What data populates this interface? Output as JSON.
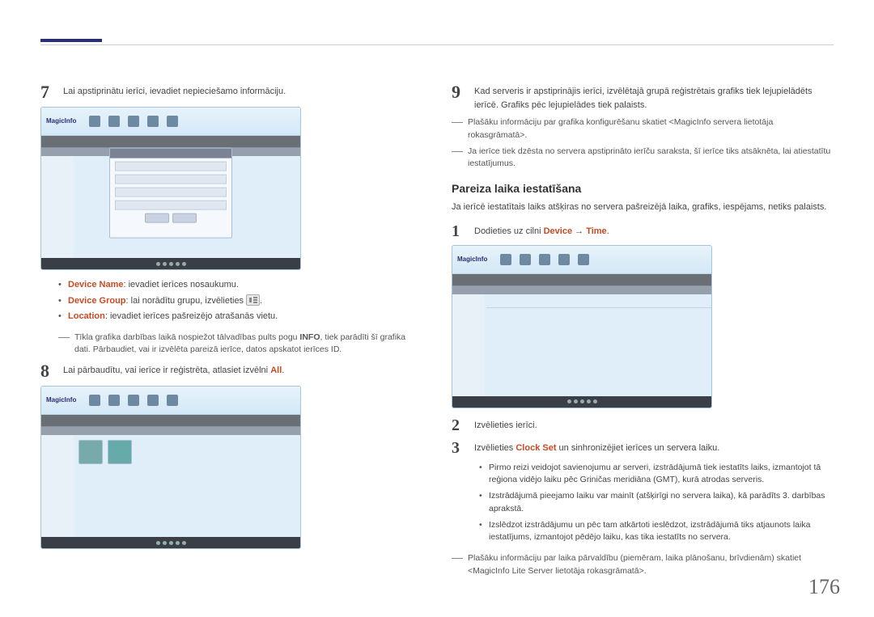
{
  "accentColor": "#c84a22",
  "page_number": "176",
  "left": {
    "step7": {
      "num": "7",
      "text": "Lai apstiprinātu ierīci, ievadiet nepieciešamo informāciju."
    },
    "bullets": {
      "b1_label": "Device Name",
      "b1_text": ": ievadiet ierīces nosaukumu.",
      "b2_label": "Device Group",
      "b2_text_a": ": lai norādītu grupu, izvēlieties ",
      "b2_text_b": ".",
      "b3_label": "Location",
      "b3_text": ": ievadiet ierīces pašreizējo atrašanās vietu."
    },
    "note_info": {
      "pre": "Tīkla grafika darbības laikā nospiežot tālvadības pults pogu ",
      "kw": "INFO",
      "post": ", tiek parādīti šī grafika dati. Pārbaudiet, vai ir izvēlēta pareizā ierīce, datos apskatot ierīces ID."
    },
    "step8": {
      "num": "8",
      "pre": "Lai pārbaudītu, vai ierīce ir reģistrēta, atlasiet izvēlni ",
      "kw": "All",
      "post": "."
    }
  },
  "right": {
    "step9": {
      "num": "9",
      "text": "Kad serveris ir apstiprinājis ierīci, izvēlētajā grupā reģistrētais grafiks tiek lejupielādēts ierīcē. Grafiks pēc lejupielādes tiek palaists."
    },
    "note1": "Plašāku informāciju par grafika konfigurēšanu skatiet <MagicInfo servera lietotāja rokasgrāmatā>.",
    "note2": "Ja ierīce tiek dzēsta no servera apstiprināto ierīču saraksta, šī ierīce tiks atsāknēta, lai atiestatītu iestatījumus.",
    "section_title": "Pareiza laika iestatīšana",
    "section_desc": "Ja ierīcē iestatītais laiks atšķiras no servera pašreizējā laika, grafiks, iespējams, netiks palaists.",
    "step1": {
      "num": "1",
      "pre": "Dodieties uz cilni ",
      "kw1": "Device",
      "arrow": " → ",
      "kw2": "Time",
      "post": "."
    },
    "step2": {
      "num": "2",
      "text": "Izvēlieties ierīci."
    },
    "step3": {
      "num": "3",
      "pre": "Izvēlieties ",
      "kw": "Clock Set",
      "post": " un sinhronizējiet ierīces un servera laiku."
    },
    "sub_bullets": {
      "s1": "Pirmo reizi veidojot savienojumu ar serveri, izstrādājumā tiek iestatīts laiks, izmantojot tā reģiona vidējo laiku pēc Griničas meridiāna (GMT), kurā atrodas serveris.",
      "s2": "Izstrādājumā pieejamo laiku var mainīt (atšķirīgi no servera laika), kā parādīts 3. darbības aprakstā.",
      "s3": "Izslēdzot izstrādājumu un pēc tam atkārtoti ieslēdzot, izstrādājumā tiks atjaunots laika iestatījums, izmantojot pēdējo laiku, kas tika iestatīts no servera."
    },
    "note3": "Plašāku informāciju par laika pārvaldību (piemēram, laika plānošanu, brīvdienām) skatiet <MagicInfo Lite Server lietotāja rokasgrāmatā>."
  },
  "screenshot_logo": "MagicInfo"
}
